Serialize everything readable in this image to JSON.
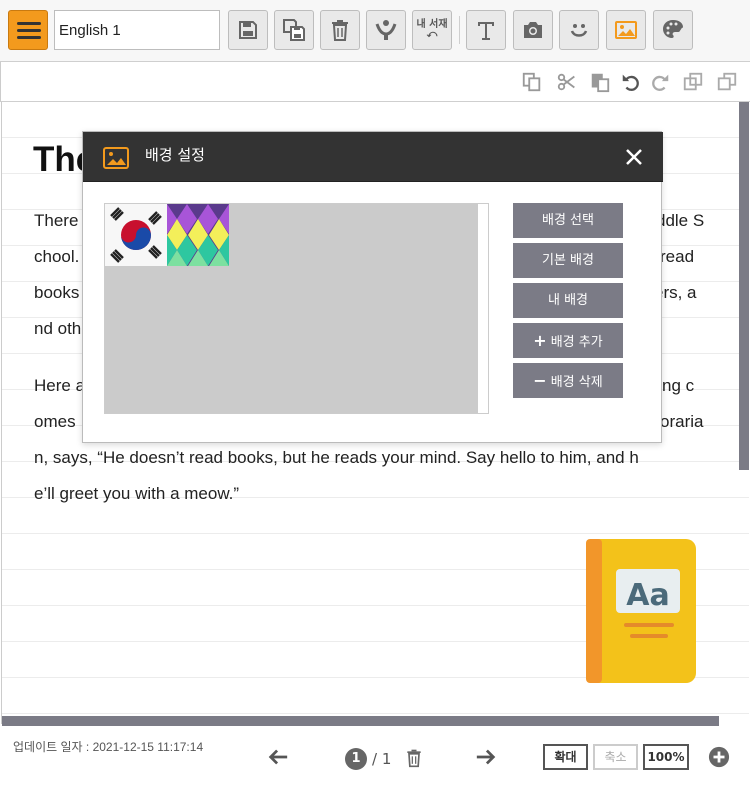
{
  "toolbar": {
    "document_name": "English 1",
    "my_library_label": "내 서재",
    "buttons": [
      "menu-icon",
      "save-icon",
      "save-as-icon",
      "trash-icon",
      "hands-icon",
      "my-library-icon",
      "text-icon",
      "camera-icon",
      "smiley-icon",
      "image-icon",
      "palette-icon"
    ],
    "accent_color": "#f39a1d"
  },
  "subbar": {
    "icons": [
      "copy-icon",
      "cut-icon",
      "paste-icon",
      "undo-icon",
      "redo-icon",
      "send-back-icon",
      "bring-front-icon"
    ]
  },
  "document": {
    "title": "The",
    "paragraph1": "There ddle S chool. read books ers, a nd oth",
    "paragraph1_parts": [
      "There",
      "ddle S",
      "chool.",
      "read",
      "books",
      "ers, a",
      "nd oth"
    ],
    "paragraph2_parts": [
      "Here a",
      "ng c",
      "omes",
      "oraria",
      "n, says, “He doesn’t read books, but he reads your mind. Say hello to him, and h",
      "e’ll greet you with a meow.”"
    ]
  },
  "modal": {
    "title": "배경 설정",
    "buttons": {
      "select": "배경 선택",
      "default": "기본 배경",
      "mine": "내 배경",
      "add": "배경 추가",
      "delete": "배경 삭제"
    },
    "thumbnails": [
      "korea-flag-thumbnail",
      "harlequin-pattern-thumbnail"
    ]
  },
  "footer": {
    "updated": "업데이트 일자 : 2021-12-15 11:17:14",
    "current_page": "1",
    "page_total": "/ 1",
    "zoom_in": "확대",
    "zoom_out": "축소",
    "zoom_level": "100%"
  }
}
